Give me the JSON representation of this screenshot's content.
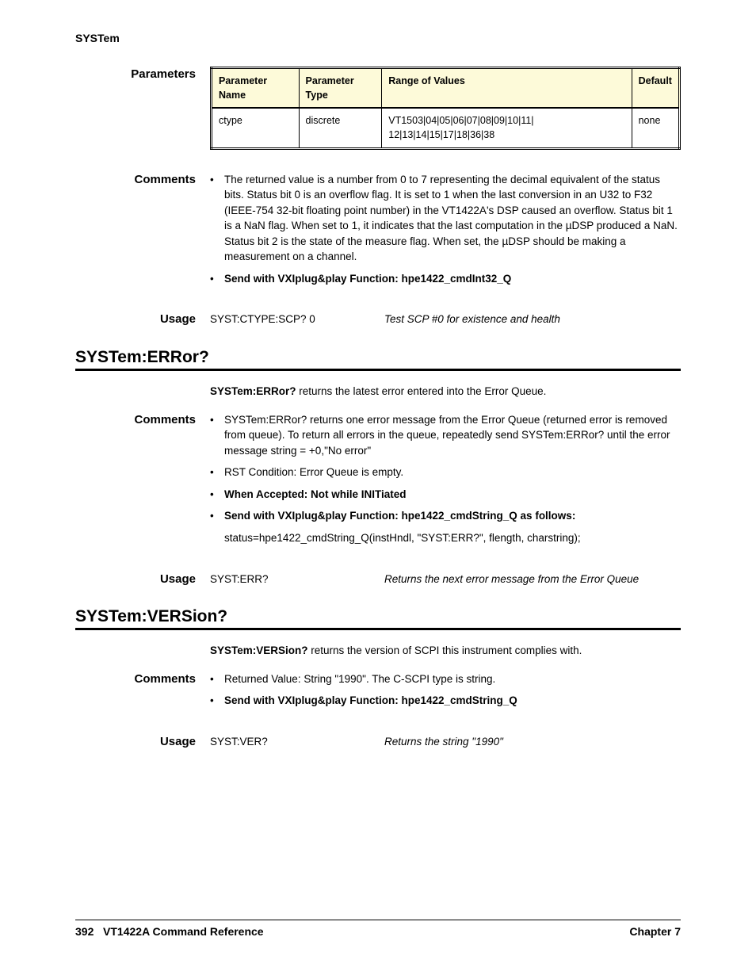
{
  "running_header": "SYSTem",
  "sec_parameters": {
    "label": "Parameters",
    "table": {
      "headers": [
        "Parameter Name",
        "Parameter Type",
        "Range of Values",
        "Default"
      ],
      "row": [
        "ctype",
        "discrete",
        "VT1503|04|05|06|07|08|09|10|11| 12|13|14|15|17|18|36|38",
        "none"
      ]
    }
  },
  "sec_comments1": {
    "label": "Comments",
    "bullets": [
      "The returned value is a number from 0 to 7 representing the decimal equivalent of the status bits. Status bit 0 is an overflow flag. It is set to 1 when the last conversion in an U32 to F32 (IEEE-754 32-bit floating point number) in the VT1422A's DSP caused an overflow. Status bit 1 is a NaN flag. When set to 1, it indicates that the last computation in the µDSP produced a NaN. Status bit 2 is the state of the measure flag. When set, the µDSP should be making a measurement on a channel.",
      "Send with VXIplug&play Function: hpe1422_cmdInt32_Q"
    ]
  },
  "sec_usage1": {
    "label": "Usage",
    "cmd": "SYST:CTYPE:SCP? 0",
    "desc": "Test SCP #0 for existence and health"
  },
  "h2_error": "SYSTem:ERRor?",
  "error_cmd_bold": "SYSTem:ERRor?",
  "error_cmd_rest": " returns the latest error entered into the Error Queue.",
  "sec_comments2": {
    "label": "Comments",
    "bullets": [
      "SYSTem:ERRor? returns one error message from the Error Queue (returned error is removed from queue). To return all errors in the queue, repeatedly send SYSTem:ERRor? until the error message string = +0,\"No error\"",
      "RST Condition: Error Queue is empty.",
      "When Accepted: Not while INITiated",
      "Send with VXIplug&play Function: hpe1422_cmdString_Q as follows:",
      "status=hpe1422_cmdString_Q(instHndl, \"SYST:ERR?\", flength, charstring);"
    ]
  },
  "sec_usage2": {
    "label": "Usage",
    "cmd": "SYST:ERR?",
    "desc": "Returns the next error message from the Error Queue"
  },
  "h2_version": "SYSTem:VERSion?",
  "version_cmd_bold": "SYSTem:VERSion?",
  "version_cmd_rest": " returns the version of SCPI this instrument complies with.",
  "sec_comments3": {
    "label": "Comments",
    "bullets": [
      "Returned Value: String \"1990\". The C-SCPI type is string.",
      "Send with VXIplug&play Function: hpe1422_cmdString_Q"
    ]
  },
  "sec_usage3": {
    "label": "Usage",
    "cmd": "SYST:VER?",
    "desc": "Returns the string \"1990\""
  },
  "footer": {
    "page": "392",
    "left": "VT1422A Command Reference",
    "right": "Chapter 7"
  }
}
